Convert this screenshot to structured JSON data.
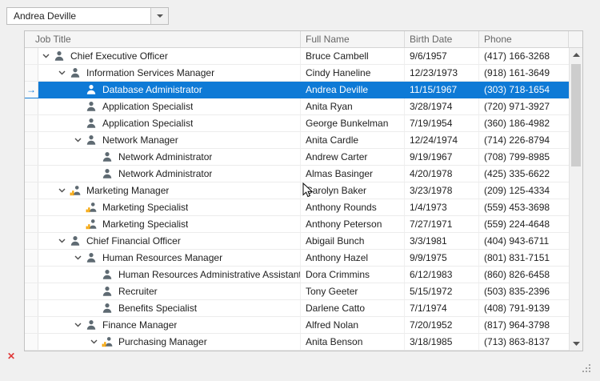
{
  "combobox": {
    "value": "Andrea Deville"
  },
  "columns": [
    "Job Title",
    "Full Name",
    "Birth Date",
    "Phone"
  ],
  "icons": {
    "focused_row_arrow": "→",
    "error": "✕"
  },
  "colors": {
    "selection": "#0e7ad6",
    "icon_gray": "#5e6a72",
    "icon_orange": "#f5a300",
    "error": "#e03a3a"
  },
  "rows": [
    {
      "level": 0,
      "has_children": true,
      "icon": "person",
      "selected": false,
      "job_title": "Chief Executive Officer",
      "full_name": "Bruce Cambell",
      "birth_date": "9/6/1957",
      "phone": "(417) 166-3268"
    },
    {
      "level": 1,
      "has_children": true,
      "icon": "person",
      "selected": false,
      "job_title": "Information Services Manager",
      "full_name": "Cindy Haneline",
      "birth_date": "12/23/1973",
      "phone": "(918) 161-3649"
    },
    {
      "level": 2,
      "has_children": false,
      "icon": "person",
      "selected": true,
      "job_title": "Database Administrator",
      "full_name": "Andrea Deville",
      "birth_date": "11/15/1967",
      "phone": "(303) 718-1654"
    },
    {
      "level": 2,
      "has_children": false,
      "icon": "person",
      "selected": false,
      "job_title": "Application Specialist",
      "full_name": "Anita Ryan",
      "birth_date": "3/28/1974",
      "phone": "(720) 971-3927"
    },
    {
      "level": 2,
      "has_children": false,
      "icon": "person",
      "selected": false,
      "job_title": "Application Specialist",
      "full_name": "George Bunkelman",
      "birth_date": "7/19/1954",
      "phone": "(360) 186-4982"
    },
    {
      "level": 2,
      "has_children": true,
      "icon": "person",
      "selected": false,
      "job_title": "Network Manager",
      "full_name": "Anita Cardle",
      "birth_date": "12/24/1974",
      "phone": "(714) 226-8794"
    },
    {
      "level": 3,
      "has_children": false,
      "icon": "person",
      "selected": false,
      "job_title": "Network Administrator",
      "full_name": "Andrew Carter",
      "birth_date": "9/19/1967",
      "phone": "(708) 799-8985"
    },
    {
      "level": 3,
      "has_children": false,
      "icon": "person",
      "selected": false,
      "job_title": "Network Administrator",
      "full_name": "Almas Basinger",
      "birth_date": "4/20/1978",
      "phone": "(425) 335-6622"
    },
    {
      "level": 1,
      "has_children": true,
      "icon": "person-chart",
      "selected": false,
      "job_title": "Marketing Manager",
      "full_name": "Carolyn Baker",
      "birth_date": "3/23/1978",
      "phone": "(209) 125-4334"
    },
    {
      "level": 2,
      "has_children": false,
      "icon": "person-chart",
      "selected": false,
      "job_title": "Marketing Specialist",
      "full_name": "Anthony Rounds",
      "birth_date": "1/4/1973",
      "phone": "(559) 453-3698"
    },
    {
      "level": 2,
      "has_children": false,
      "icon": "person-chart",
      "selected": false,
      "job_title": "Marketing Specialist",
      "full_name": "Anthony Peterson",
      "birth_date": "7/27/1971",
      "phone": "(559) 224-4648"
    },
    {
      "level": 1,
      "has_children": true,
      "icon": "person",
      "selected": false,
      "job_title": "Chief Financial Officer",
      "full_name": "Abigail Bunch",
      "birth_date": "3/3/1981",
      "phone": "(404) 943-6711"
    },
    {
      "level": 2,
      "has_children": true,
      "icon": "person",
      "selected": false,
      "job_title": "Human Resources Manager",
      "full_name": "Anthony Hazel",
      "birth_date": "9/9/1975",
      "phone": "(801) 831-7151"
    },
    {
      "level": 3,
      "has_children": false,
      "icon": "person",
      "selected": false,
      "job_title": "Human Resources Administrative Assistant",
      "full_name": "Dora Crimmins",
      "birth_date": "6/12/1983",
      "phone": "(860) 826-6458"
    },
    {
      "level": 3,
      "has_children": false,
      "icon": "person",
      "selected": false,
      "job_title": "Recruiter",
      "full_name": "Tony Geeter",
      "birth_date": "5/15/1972",
      "phone": "(503) 835-2396"
    },
    {
      "level": 3,
      "has_children": false,
      "icon": "person",
      "selected": false,
      "job_title": "Benefits Specialist",
      "full_name": "Darlene Catto",
      "birth_date": "7/1/1974",
      "phone": "(408) 791-9139"
    },
    {
      "level": 2,
      "has_children": true,
      "icon": "person",
      "selected": false,
      "job_title": "Finance Manager",
      "full_name": "Alfred Nolan",
      "birth_date": "7/20/1952",
      "phone": "(817) 964-3798"
    },
    {
      "level": 3,
      "has_children": true,
      "icon": "person-chart",
      "selected": false,
      "job_title": "Purchasing Manager",
      "full_name": "Anita Benson",
      "birth_date": "3/18/1985",
      "phone": "(713) 863-8137"
    }
  ]
}
